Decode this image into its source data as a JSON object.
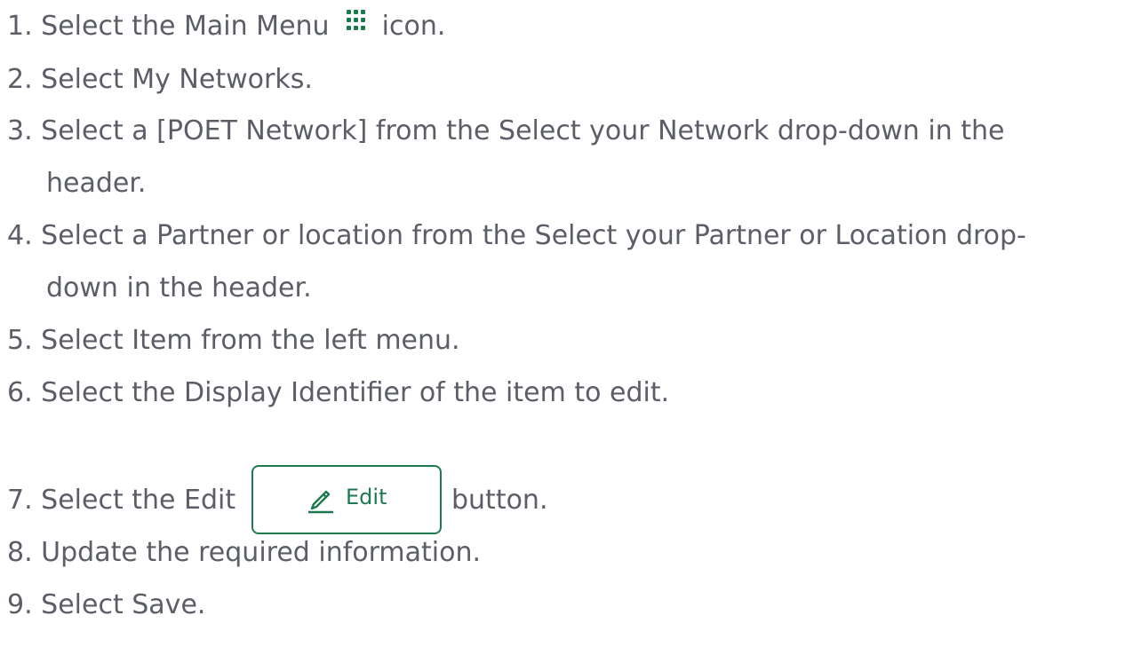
{
  "steps": [
    {
      "num": "1.",
      "before": "Select the Main Menu",
      "after": "icon."
    },
    {
      "num": "2.",
      "text": "Select My Networks."
    },
    {
      "num": "3.",
      "line1": "Select a [POET Network] from the Select your Network drop-down in the",
      "line2": "header."
    },
    {
      "num": "4.",
      "line1": "Select a Partner or location from the Select your Partner or Location drop-",
      "line2": "down in the header."
    },
    {
      "num": "5.",
      "text": "Select Item from the left menu."
    },
    {
      "num": "6.",
      "text": "Select the Display Identifier of the item to edit."
    },
    {
      "num": "7.",
      "before": "Select the Edit",
      "after": "button."
    },
    {
      "num": "8.",
      "text": "Update the required information."
    },
    {
      "num": "9.",
      "text": "Select Save."
    }
  ],
  "edit_button": {
    "label": "Edit",
    "icon": "pencil-icon"
  },
  "main_menu_icon": "grid-icon",
  "colors": {
    "text": "#5b5e66",
    "accent": "#1e7a4e"
  }
}
